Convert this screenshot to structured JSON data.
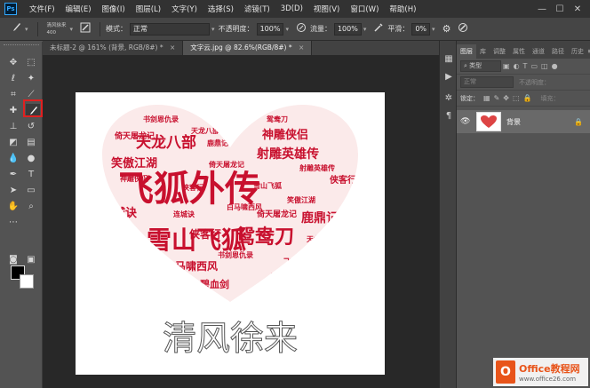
{
  "menubar": {
    "logo": "Ps",
    "items": [
      "文件(F)",
      "编辑(E)",
      "图像(I)",
      "图层(L)",
      "文字(Y)",
      "选择(S)",
      "滤镜(T)",
      "3D(D)",
      "视图(V)",
      "窗口(W)",
      "帮助(H)"
    ],
    "window_controls": [
      "—",
      "☐",
      "✕"
    ]
  },
  "options": {
    "brush_preset_title": "清风徐来",
    "brush_preset_size": "400",
    "mode_label": "模式：",
    "mode_value": "正常",
    "opacity_label": "不透明度：",
    "opacity_value": "100%",
    "flow_label": "流量：",
    "flow_value": "100%",
    "smooth_label": "平滑：",
    "smooth_value": "0%"
  },
  "document": {
    "tabs": [
      {
        "label": "未标题-2 @ 161% (背景, RGB/8#) *",
        "active": false
      },
      {
        "label": "文字云.jpg @ 82.6%(RGB/8#) *",
        "active": true
      }
    ],
    "close_glyph": "×",
    "canvas_caption": "清风徐来",
    "wordcloud": [
      "飞狐外传",
      "雪山飞狐",
      "连城诀",
      "鹿鼎记",
      "天龙八部",
      "射雕英雄传",
      "神雕侠侣",
      "笑傲江湖",
      "连城诀",
      "侠客行",
      "白马啸西风",
      "碧血剑",
      "鸳鸯刀",
      "书剑恩仇录",
      "倚天屠龙记",
      "侠客行",
      "雪山飞狐",
      "鸳鸯刀",
      "倚天屠龙记",
      "白马啸西风",
      "天龙八部",
      "鹿鼎记",
      "飞狐外传",
      "书剑恩仇录",
      "侠客行",
      "碧血剑",
      "神雕侠侣",
      "鸳鸯刀",
      "连城诀",
      "笑傲江湖",
      "天龙八部",
      "倚天屠龙记",
      "射雕英雄传",
      "书剑恩仇录"
    ]
  },
  "layers_panel": {
    "tabs": [
      "图层",
      "库",
      "调整",
      "属性",
      "通道",
      "路径",
      "历史"
    ],
    "filter_label": "类型",
    "blend_mode": "正常",
    "opacity_label": "不透明度：",
    "lock_label": "锁定：",
    "fill_label": "填充：",
    "layer_name": "背景"
  },
  "watermark": {
    "logo": "O",
    "title": "Office教程网",
    "url": "www.office26.com"
  },
  "colors": {
    "accent_red": "#c8102e",
    "highlight": "#e02020",
    "watermark": "#e8541a"
  }
}
